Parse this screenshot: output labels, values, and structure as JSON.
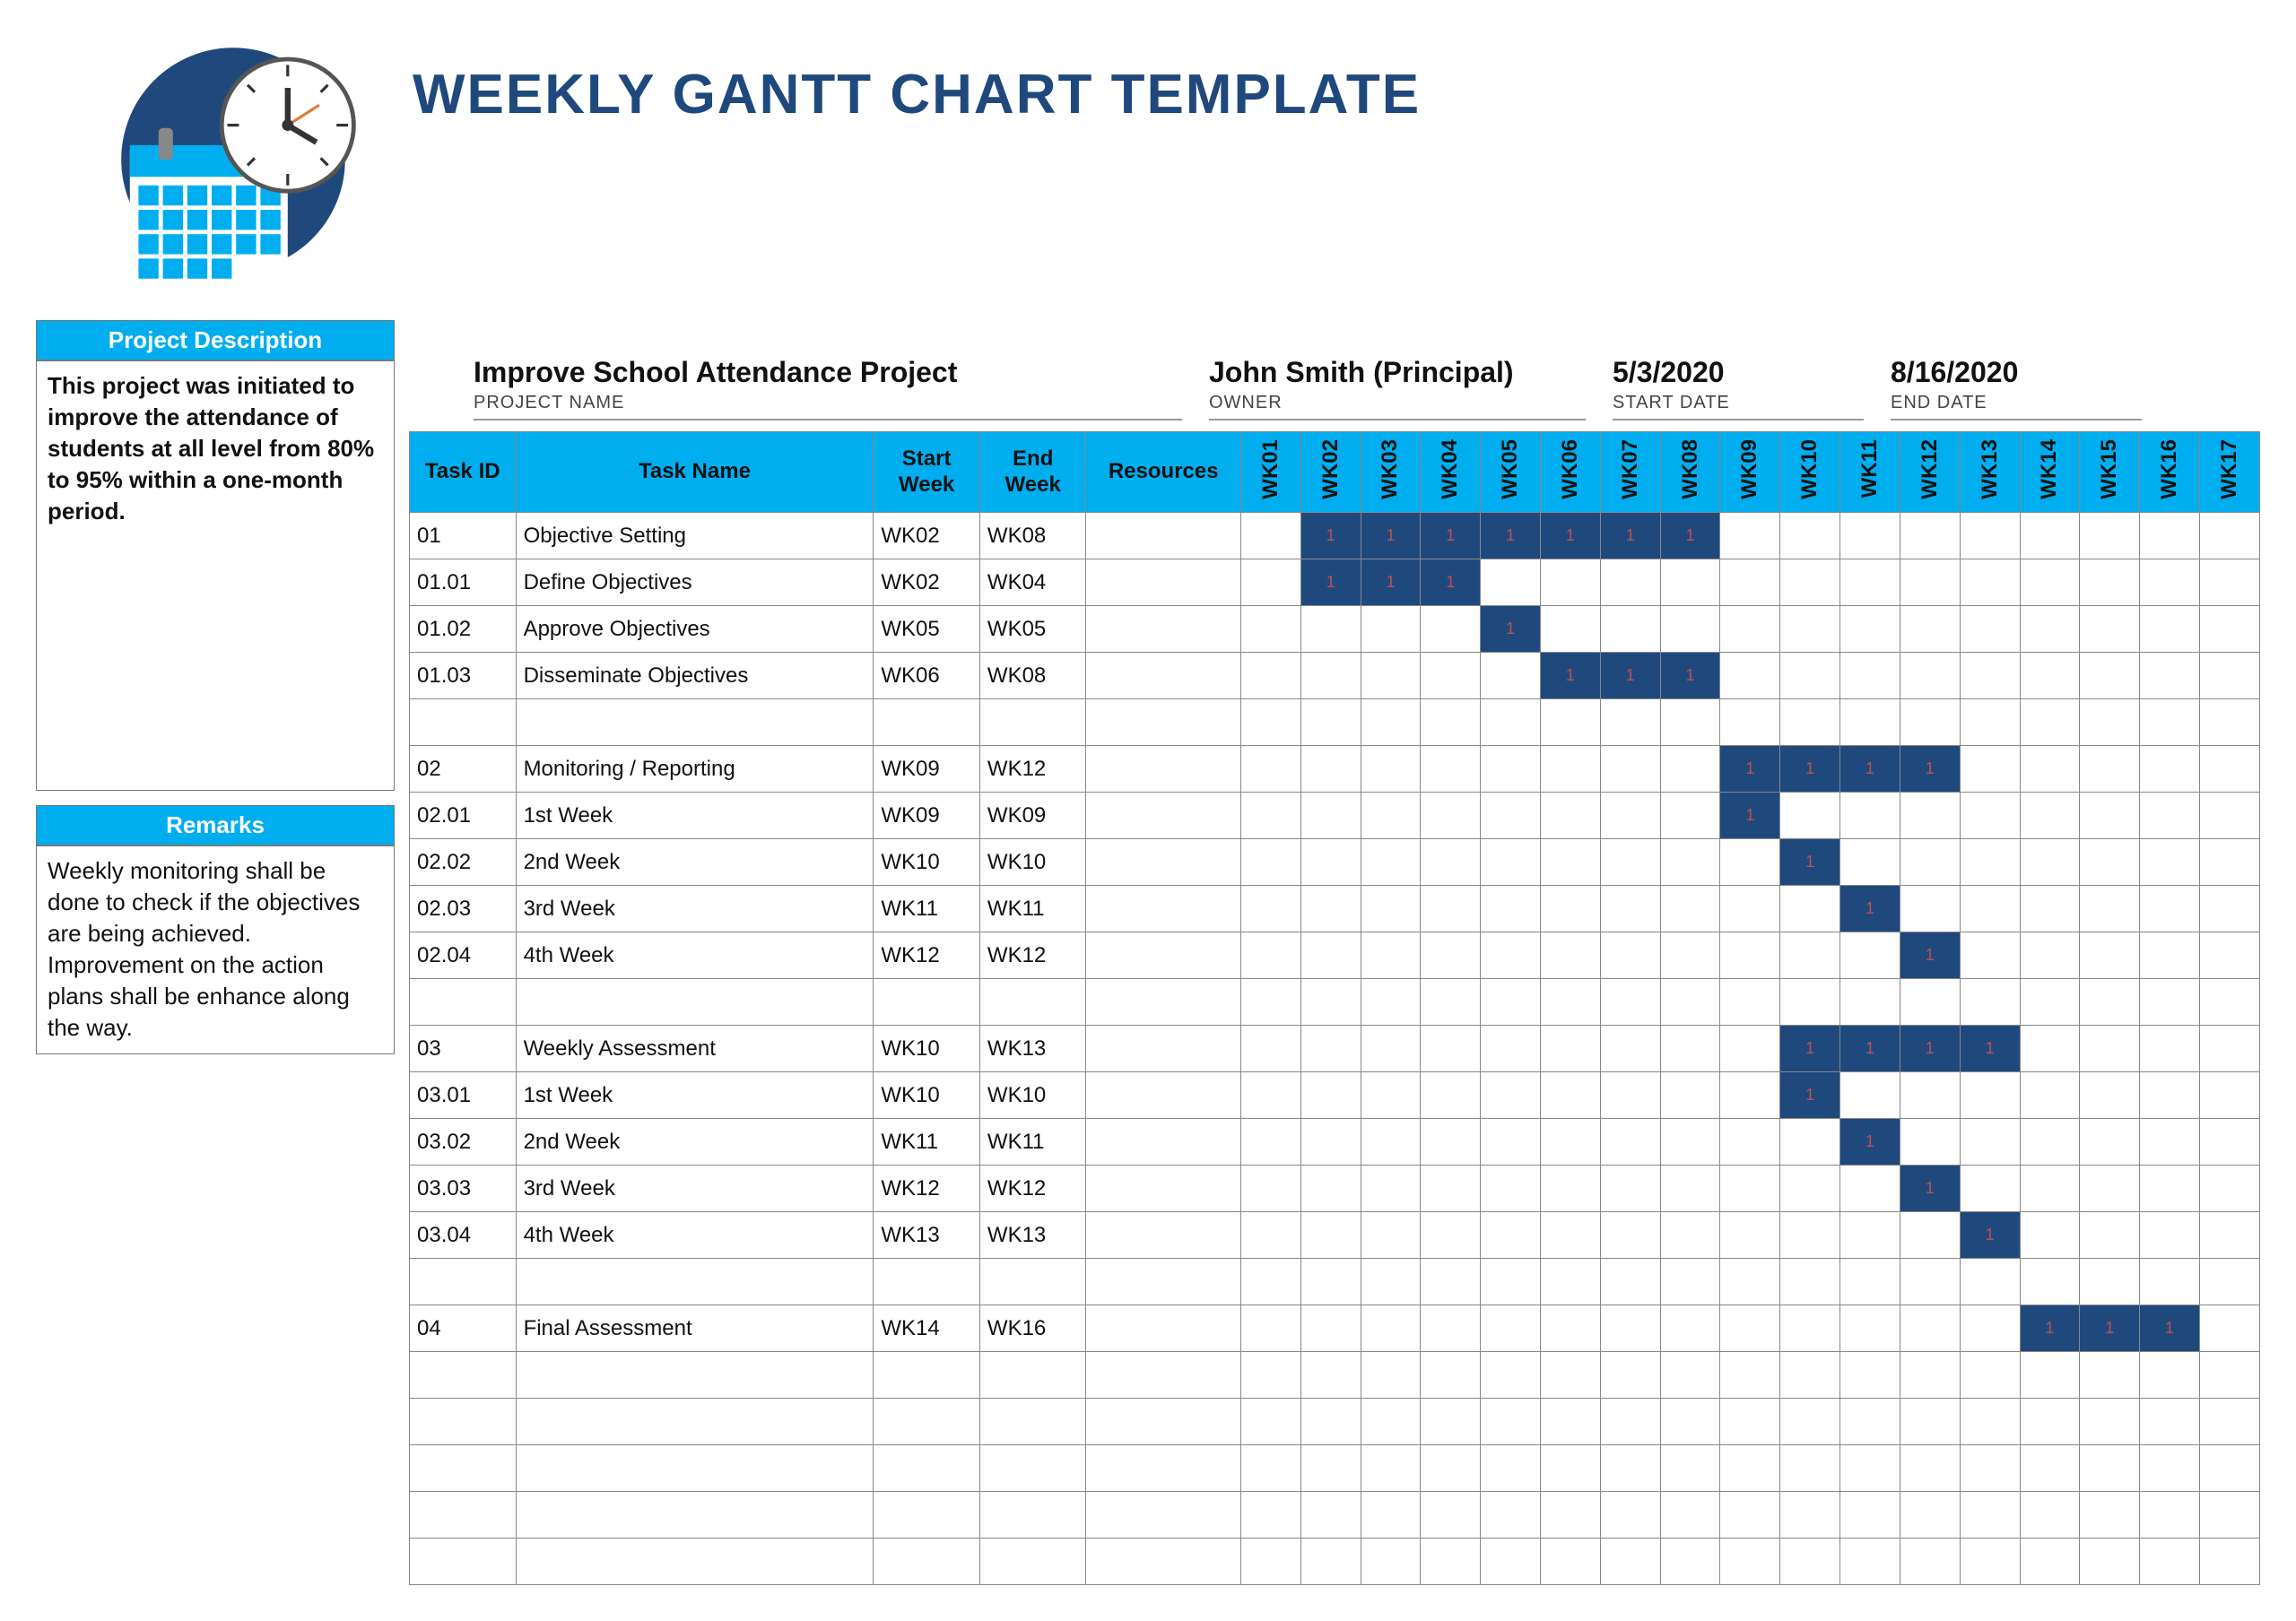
{
  "title": "WEEKLY GANTT CHART TEMPLATE",
  "meta": {
    "project_name": "Improve School Attendance Project",
    "project_label": "PROJECT NAME",
    "owner": "John Smith (Principal)",
    "owner_label": "OWNER",
    "start_date": "5/3/2020",
    "start_label": "START DATE",
    "end_date": "8/16/2020",
    "end_label": "END DATE"
  },
  "sidebar": {
    "desc_title": "Project Description",
    "desc_body": "This project was initiated to improve the attendance of students at all level from 80% to 95% within a one-month period.",
    "remarks_title": "Remarks",
    "remarks_body": "Weekly monitoring shall be done to check if the objectives are being achieved.\nImprovement on the action plans shall be enhance along the way."
  },
  "headers": {
    "task_id": "Task ID",
    "task_name": "Task Name",
    "start_week": "Start Week",
    "end_week": "End Week",
    "resources": "Resources"
  },
  "weeks": [
    "WK01",
    "WK02",
    "WK03",
    "WK04",
    "WK05",
    "WK06",
    "WK07",
    "WK08",
    "WK09",
    "WK10",
    "WK11",
    "WK12",
    "WK13",
    "WK14",
    "WK15",
    "WK16",
    "WK17"
  ],
  "rows": [
    {
      "id": "01",
      "name": "Objective Setting",
      "sw": "WK02",
      "ew": "WK08",
      "res": "",
      "start": 2,
      "end": 8
    },
    {
      "id": "01.01",
      "name": "Define Objectives",
      "sw": "WK02",
      "ew": "WK04",
      "res": "",
      "start": 2,
      "end": 4
    },
    {
      "id": "01.02",
      "name": "Approve Objectives",
      "sw": "WK05",
      "ew": "WK05",
      "res": "",
      "start": 5,
      "end": 5
    },
    {
      "id": "01.03",
      "name": "Disseminate Objectives",
      "sw": "WK06",
      "ew": "WK08",
      "res": "",
      "start": 6,
      "end": 8
    },
    {
      "id": "",
      "name": "",
      "sw": "",
      "ew": "",
      "res": "",
      "start": 0,
      "end": 0
    },
    {
      "id": "02",
      "name": "Monitoring / Reporting",
      "sw": "WK09",
      "ew": "WK12",
      "res": "",
      "start": 9,
      "end": 12
    },
    {
      "id": "02.01",
      "name": "1st Week",
      "sw": "WK09",
      "ew": "WK09",
      "res": "",
      "start": 9,
      "end": 9
    },
    {
      "id": "02.02",
      "name": "2nd Week",
      "sw": "WK10",
      "ew": "WK10",
      "res": "",
      "start": 10,
      "end": 10
    },
    {
      "id": "02.03",
      "name": "3rd Week",
      "sw": "WK11",
      "ew": "WK11",
      "res": "",
      "start": 11,
      "end": 11
    },
    {
      "id": "02.04",
      "name": "4th Week",
      "sw": "WK12",
      "ew": "WK12",
      "res": "",
      "start": 12,
      "end": 12
    },
    {
      "id": "",
      "name": "",
      "sw": "",
      "ew": "",
      "res": "",
      "start": 0,
      "end": 0
    },
    {
      "id": "03",
      "name": "Weekly Assessment",
      "sw": "WK10",
      "ew": "WK13",
      "res": "",
      "start": 10,
      "end": 13
    },
    {
      "id": "03.01",
      "name": "1st Week",
      "sw": "WK10",
      "ew": "WK10",
      "res": "",
      "start": 10,
      "end": 10
    },
    {
      "id": "03.02",
      "name": "2nd Week",
      "sw": "WK11",
      "ew": "WK11",
      "res": "",
      "start": 11,
      "end": 11
    },
    {
      "id": "03.03",
      "name": "3rd Week",
      "sw": "WK12",
      "ew": "WK12",
      "res": "",
      "start": 12,
      "end": 12
    },
    {
      "id": "03.04",
      "name": "4th Week",
      "sw": "WK13",
      "ew": "WK13",
      "res": "",
      "start": 13,
      "end": 13
    },
    {
      "id": "",
      "name": "",
      "sw": "",
      "ew": "",
      "res": "",
      "start": 0,
      "end": 0
    },
    {
      "id": "04",
      "name": "Final Assessment",
      "sw": "WK14",
      "ew": "WK16",
      "res": "",
      "start": 14,
      "end": 16
    },
    {
      "id": "",
      "name": "",
      "sw": "",
      "ew": "",
      "res": "",
      "start": 0,
      "end": 0
    },
    {
      "id": "",
      "name": "",
      "sw": "",
      "ew": "",
      "res": "",
      "start": 0,
      "end": 0
    },
    {
      "id": "",
      "name": "",
      "sw": "",
      "ew": "",
      "res": "",
      "start": 0,
      "end": 0
    },
    {
      "id": "",
      "name": "",
      "sw": "",
      "ew": "",
      "res": "",
      "start": 0,
      "end": 0
    },
    {
      "id": "",
      "name": "",
      "sw": "",
      "ew": "",
      "res": "",
      "start": 0,
      "end": 0
    }
  ],
  "chart_data": {
    "type": "bar",
    "title": "Weekly Gantt Chart Template",
    "xlabel": "Week",
    "ylabel": "Task",
    "x_categories": [
      "WK01",
      "WK02",
      "WK03",
      "WK04",
      "WK05",
      "WK06",
      "WK07",
      "WK08",
      "WK09",
      "WK10",
      "WK11",
      "WK12",
      "WK13",
      "WK14",
      "WK15",
      "WK16",
      "WK17"
    ],
    "series": [
      {
        "name": "01 Objective Setting",
        "start": "WK02",
        "end": "WK08"
      },
      {
        "name": "01.01 Define Objectives",
        "start": "WK02",
        "end": "WK04"
      },
      {
        "name": "01.02 Approve Objectives",
        "start": "WK05",
        "end": "WK05"
      },
      {
        "name": "01.03 Disseminate Objectives",
        "start": "WK06",
        "end": "WK08"
      },
      {
        "name": "02 Monitoring / Reporting",
        "start": "WK09",
        "end": "WK12"
      },
      {
        "name": "02.01 1st Week",
        "start": "WK09",
        "end": "WK09"
      },
      {
        "name": "02.02 2nd Week",
        "start": "WK10",
        "end": "WK10"
      },
      {
        "name": "02.03 3rd Week",
        "start": "WK11",
        "end": "WK11"
      },
      {
        "name": "02.04 4th Week",
        "start": "WK12",
        "end": "WK12"
      },
      {
        "name": "03 Weekly Assessment",
        "start": "WK10",
        "end": "WK13"
      },
      {
        "name": "03.01 1st Week",
        "start": "WK10",
        "end": "WK10"
      },
      {
        "name": "03.02 2nd Week",
        "start": "WK11",
        "end": "WK11"
      },
      {
        "name": "03.03 3rd Week",
        "start": "WK12",
        "end": "WK12"
      },
      {
        "name": "03.04 4th Week",
        "start": "WK13",
        "end": "WK13"
      },
      {
        "name": "04 Final Assessment",
        "start": "WK14",
        "end": "WK16"
      }
    ]
  }
}
